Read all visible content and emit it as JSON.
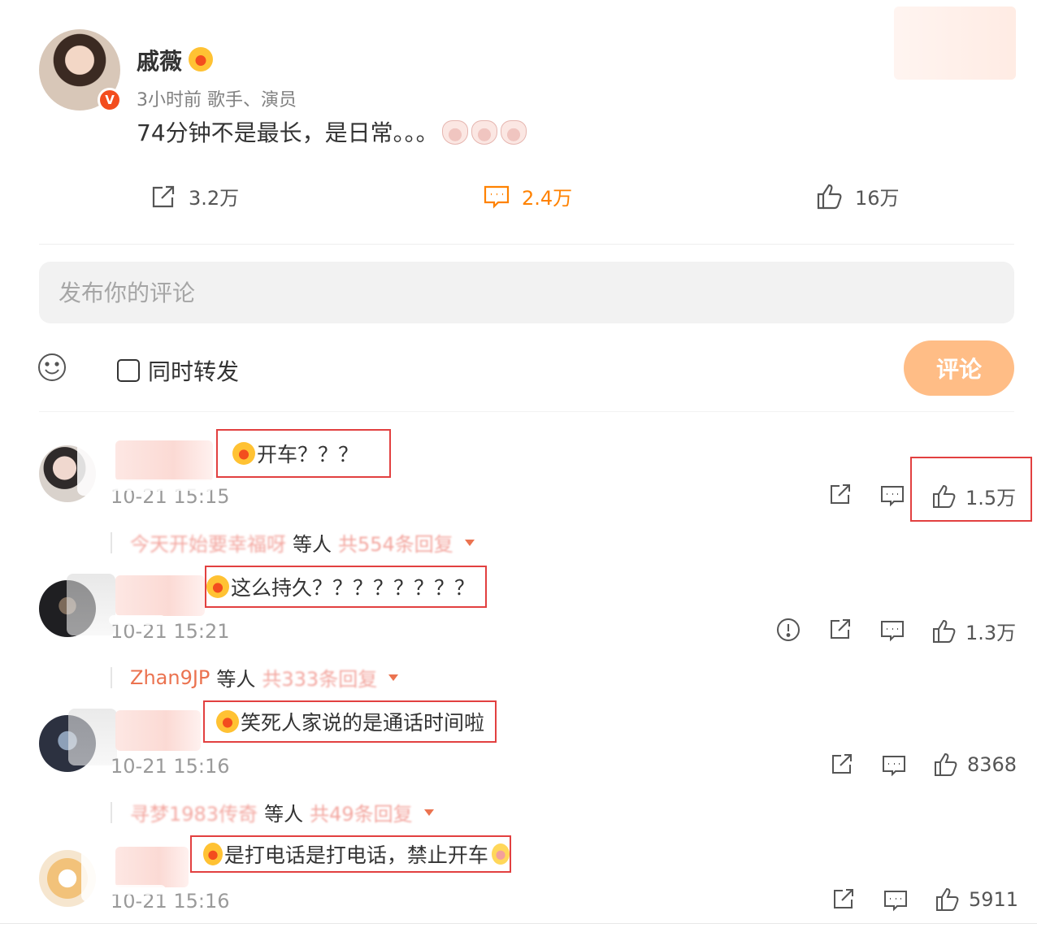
{
  "post": {
    "author": "戚薇",
    "meta": "3小时前 歌手、演员",
    "text": "74分钟不是最长，是日常。。。",
    "repost_count": "3.2万",
    "comment_count": "2.4万",
    "like_count": "16万"
  },
  "composer": {
    "placeholder": "发布你的评论",
    "repost_label": "同时转发",
    "submit_label": "评论"
  },
  "comments": [
    {
      "text": "开车？？？",
      "time": "10-21 15:15",
      "like_count": "1.5万",
      "reply_name": "今天开始要幸福呀",
      "reply_suffix": "等人",
      "reply_count": "共554条回复"
    },
    {
      "text": "这么持久？？？？？？？？",
      "time": "10-21 15:21",
      "like_count": "1.3万",
      "reply_name": "Zhan9JP",
      "reply_suffix": "等人",
      "reply_count": "共333条回复"
    },
    {
      "text": "笑死人家说的是通话时间啦",
      "time": "10-21 15:16",
      "like_count": "8368",
      "reply_name": "寻梦1983传奇",
      "reply_suffix": "等人",
      "reply_count": "共49条回复"
    },
    {
      "text": "是打电话是打电话，禁止开车",
      "time": "10-21 15:16",
      "like_count": "5911"
    }
  ],
  "colors": {
    "accent": "#ff8200",
    "submit_bg": "#ffbd86",
    "highlight_border": "#e24040",
    "verified": "#f34d1e"
  },
  "icons": [
    "repost-icon",
    "comment-icon",
    "like-icon",
    "smile-icon",
    "report-icon",
    "crown-icon",
    "verified-icon"
  ]
}
